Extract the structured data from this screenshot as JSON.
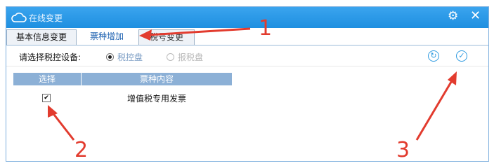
{
  "window": {
    "title": "在线变更"
  },
  "tabs": [
    {
      "label": "基本信息变更"
    },
    {
      "label": "票种增加"
    },
    {
      "label": "税号变更"
    }
  ],
  "device": {
    "label": "请选择税控设备:",
    "options": [
      {
        "label": "税控盘",
        "selected": true
      },
      {
        "label": "报税盘",
        "selected": false
      }
    ]
  },
  "table": {
    "columns": [
      "选择",
      "票种内容"
    ],
    "rows": [
      {
        "checked": true,
        "content": "增值税专用发票"
      }
    ]
  },
  "annotations": [
    "1",
    "2",
    "3"
  ],
  "colors": {
    "titlebar": "#1e8fe0",
    "accent": "#2f9be0",
    "annotation": "#e23b2e"
  }
}
